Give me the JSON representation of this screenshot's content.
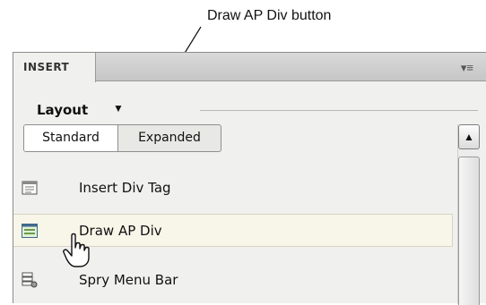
{
  "callout": {
    "text": "Draw AP Div button"
  },
  "panel": {
    "tab_label": "INSERT",
    "menu_icon": "panel-menu-icon",
    "category": {
      "label": "Layout",
      "arrow": "▼"
    },
    "modes": [
      {
        "label": "Standard",
        "selected": true
      },
      {
        "label": "Expanded",
        "selected": false
      }
    ],
    "items": [
      {
        "label": "Insert Div Tag",
        "icon": "insert-div-tag-icon"
      },
      {
        "label": "Draw AP Div",
        "icon": "draw-ap-div-icon",
        "hovered": true
      },
      {
        "label": "Spry Menu Bar",
        "icon": "spry-menu-bar-icon"
      }
    ],
    "scroll_up_glyph": "▲"
  },
  "colors": {
    "panel_bg": "#f0f0ef",
    "hover_bg": "#f8f5e9",
    "tabbar": "#cfcfcf"
  }
}
